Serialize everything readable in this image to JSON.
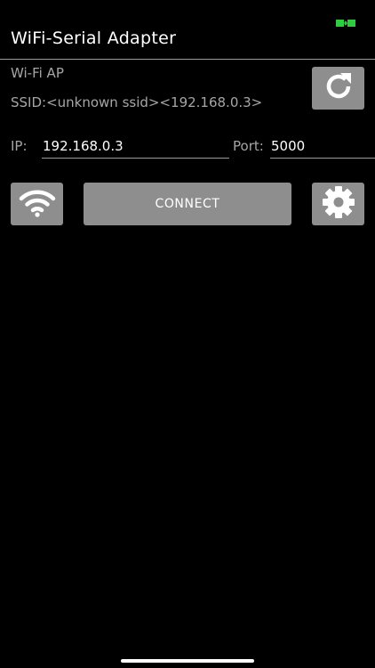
{
  "app": {
    "title": "WiFi-Serial Adapter"
  },
  "status": {
    "indicator_icon": "link-status-icon",
    "indicator_color": "#2ecc40"
  },
  "network": {
    "mode_label": "Wi-Fi AP",
    "ssid_text": "SSID:<unknown ssid><192.168.0.3>"
  },
  "connection": {
    "ip_label": "IP:",
    "ip_value": "192.168.0.3",
    "port_label": "Port:",
    "port_value": "5000"
  },
  "buttons": {
    "connect_label": "CONNECT",
    "refresh_icon": "refresh-icon",
    "wifi_icon": "wifi-icon",
    "settings_icon": "gear-icon"
  },
  "colors": {
    "background": "#000000",
    "button": "#8e8e8e",
    "secondary_text": "#a6a6a6"
  }
}
